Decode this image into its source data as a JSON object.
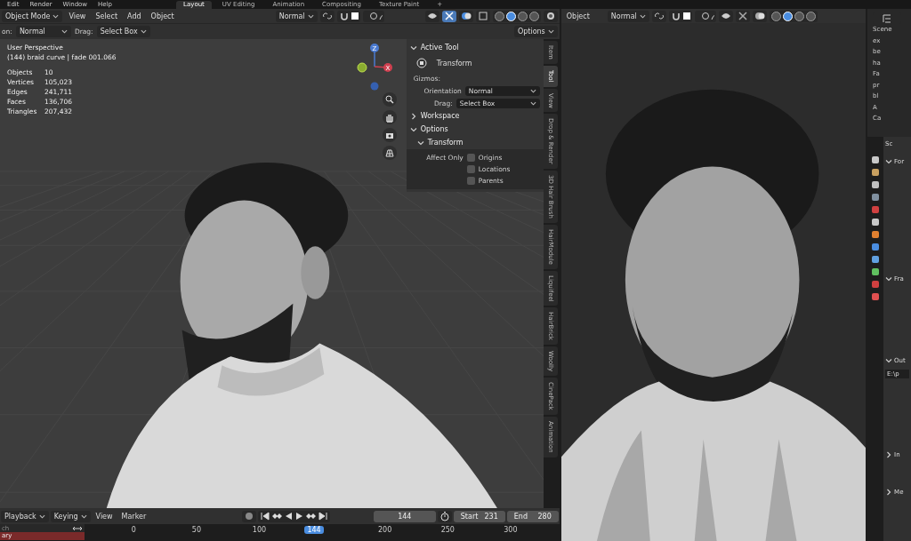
{
  "top_menu": [
    "Edit",
    "Render",
    "Window",
    "Help"
  ],
  "workspace_tabs": [
    {
      "label": "Layout",
      "selected": true
    },
    {
      "label": "UV Editing",
      "selected": false
    },
    {
      "label": "Animation",
      "selected": false
    },
    {
      "label": "Compositing",
      "selected": false
    },
    {
      "label": "Texture Paint",
      "selected": false
    },
    {
      "label": "+",
      "selected": false
    }
  ],
  "left_view": {
    "mode": "Object Mode",
    "menus": [
      "View",
      "Select",
      "Add",
      "Object"
    ],
    "orientation": "Normal",
    "shading": [
      {
        "selected": false
      },
      {
        "selected": true
      },
      {
        "selected": false
      },
      {
        "selected": false
      }
    ],
    "tool_header": {
      "orientation_label": "on:",
      "orientation": "Normal",
      "drag_label": "Drag:",
      "drag": "Select Box",
      "options": "Options"
    },
    "overlay": {
      "view_name": "User Perspective",
      "object_line": "(144) braid curve | fade 001.066",
      "stats": [
        {
          "label": "Objects",
          "value": "10"
        },
        {
          "label": "Vertices",
          "value": "105,023"
        },
        {
          "label": "Edges",
          "value": "241,711"
        },
        {
          "label": "Faces",
          "value": "136,706"
        },
        {
          "label": "Triangles",
          "value": "207,432"
        }
      ]
    },
    "gizmo": {
      "z": "Z",
      "x": "X"
    },
    "sidebar": {
      "panels": [
        {
          "kind": "active_tool",
          "title": "Active Tool",
          "expanded": true,
          "tool": "Transform",
          "gizmos_label": "Gizmos:",
          "orientation_label": "Orientation",
          "orientation": "Normal",
          "drag_label": "Drag:",
          "drag": "Select Box"
        },
        {
          "kind": "plain",
          "title": "Workspace",
          "expanded": false
        },
        {
          "kind": "options",
          "title": "Options",
          "expanded": true,
          "sub": {
            "title": "Transform",
            "expanded": true,
            "label": "Affect Only",
            "checks": [
              {
                "label": "Origins",
                "checked": false
              },
              {
                "label": "Locations",
                "checked": false
              },
              {
                "label": "Parents",
                "checked": false
              }
            ]
          }
        }
      ]
    },
    "sidebar_tabs": [
      {
        "label": "Item",
        "selected": false
      },
      {
        "label": "Tool",
        "selected": true
      },
      {
        "label": "View",
        "selected": false
      },
      {
        "label": "Drop & Render",
        "selected": false
      },
      {
        "label": "3D Hair Brush",
        "selected": false
      },
      {
        "label": "HairModule",
        "selected": false
      },
      {
        "label": "Liquifeel",
        "selected": false
      },
      {
        "label": "HairBrick",
        "selected": false
      },
      {
        "label": "Woolly",
        "selected": false
      },
      {
        "label": "CinePack",
        "selected": false
      },
      {
        "label": "Animation",
        "selected": false
      }
    ]
  },
  "timeline": {
    "menus": [
      "Playback",
      "Keying",
      "View",
      "Marker"
    ],
    "current_frame": "144",
    "start_label": "Start",
    "start": "231",
    "end_label": "End",
    "end": "280",
    "search": "ch",
    "track": "ary",
    "ticks_before": [
      "0",
      "50",
      "100"
    ],
    "playhead": "144",
    "ticks_after": [
      "200",
      "250",
      "300"
    ]
  },
  "right_view": {
    "mode": "Object",
    "orientation": "Normal",
    "shading": [
      {
        "selected": false
      },
      {
        "selected": true
      },
      {
        "selected": false
      },
      {
        "selected": false
      }
    ]
  },
  "outliner": {
    "items": [
      "Scene",
      "ex",
      "be",
      "ha",
      "Fa",
      "pr",
      "bl",
      "A",
      "Ca"
    ]
  },
  "properties": {
    "header": "Sc",
    "sections": [
      {
        "title": "For",
        "expanded": true
      },
      {
        "title": "Fra",
        "expanded": true
      },
      {
        "title": "Out",
        "expanded": true,
        "field": "E:\\p"
      },
      {
        "title": "In",
        "expanded": false
      },
      {
        "title": "Me",
        "expanded": false
      }
    ]
  }
}
